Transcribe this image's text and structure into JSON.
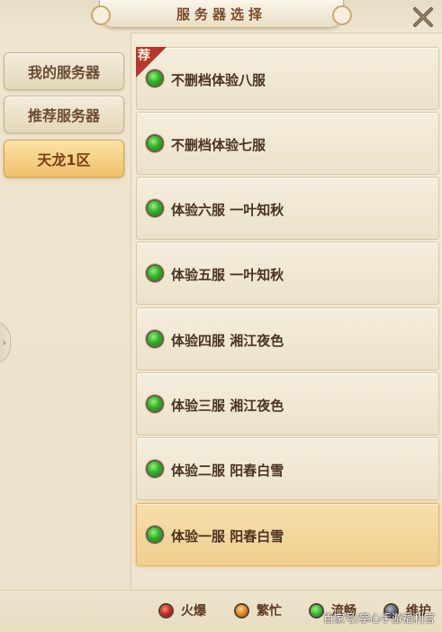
{
  "header": {
    "title": "服务器选择",
    "close_icon": "close-x-icon"
  },
  "sidebar": {
    "tabs": [
      {
        "label": "我的服务器",
        "active": false
      },
      {
        "label": "推荐服务器",
        "active": false
      },
      {
        "label": "天龙1区",
        "active": true
      }
    ]
  },
  "servers": [
    {
      "name": "不删档体验八服",
      "status": "流畅",
      "recommended": true,
      "badge": "荐",
      "selected": false
    },
    {
      "name": "不删档体验七服",
      "status": "流畅",
      "recommended": false,
      "selected": false
    },
    {
      "name": "体验六服 一叶知秋",
      "status": "流畅",
      "recommended": false,
      "selected": false
    },
    {
      "name": "体验五服 一叶知秋",
      "status": "流畅",
      "recommended": false,
      "selected": false
    },
    {
      "name": "体验四服 湘江夜色",
      "status": "流畅",
      "recommended": false,
      "selected": false
    },
    {
      "name": "体验三服 湘江夜色",
      "status": "流畅",
      "recommended": false,
      "selected": false
    },
    {
      "name": "体验二服 阳春白雪",
      "status": "流畅",
      "recommended": false,
      "selected": false
    },
    {
      "name": "体验一服 阳春白雪",
      "status": "流畅",
      "recommended": false,
      "selected": true
    }
  ],
  "legend": [
    {
      "label": "火爆",
      "color": "#c8201c",
      "icon": "status-hot-dot-icon"
    },
    {
      "label": "繁忙",
      "color": "#e0801c",
      "icon": "status-busy-dot-icon"
    },
    {
      "label": "流畅",
      "color": "#2fb42a",
      "icon": "status-smooth-dot-icon"
    },
    {
      "label": "维护",
      "color": "#5a5f70",
      "icon": "status-maintenance-dot-icon"
    }
  ],
  "watermark": "百家号/掌心手游福利官",
  "colors": {
    "accent_gold": "#f1c16b",
    "text_brown": "#4a3420",
    "badge_red": "#b5372a"
  }
}
